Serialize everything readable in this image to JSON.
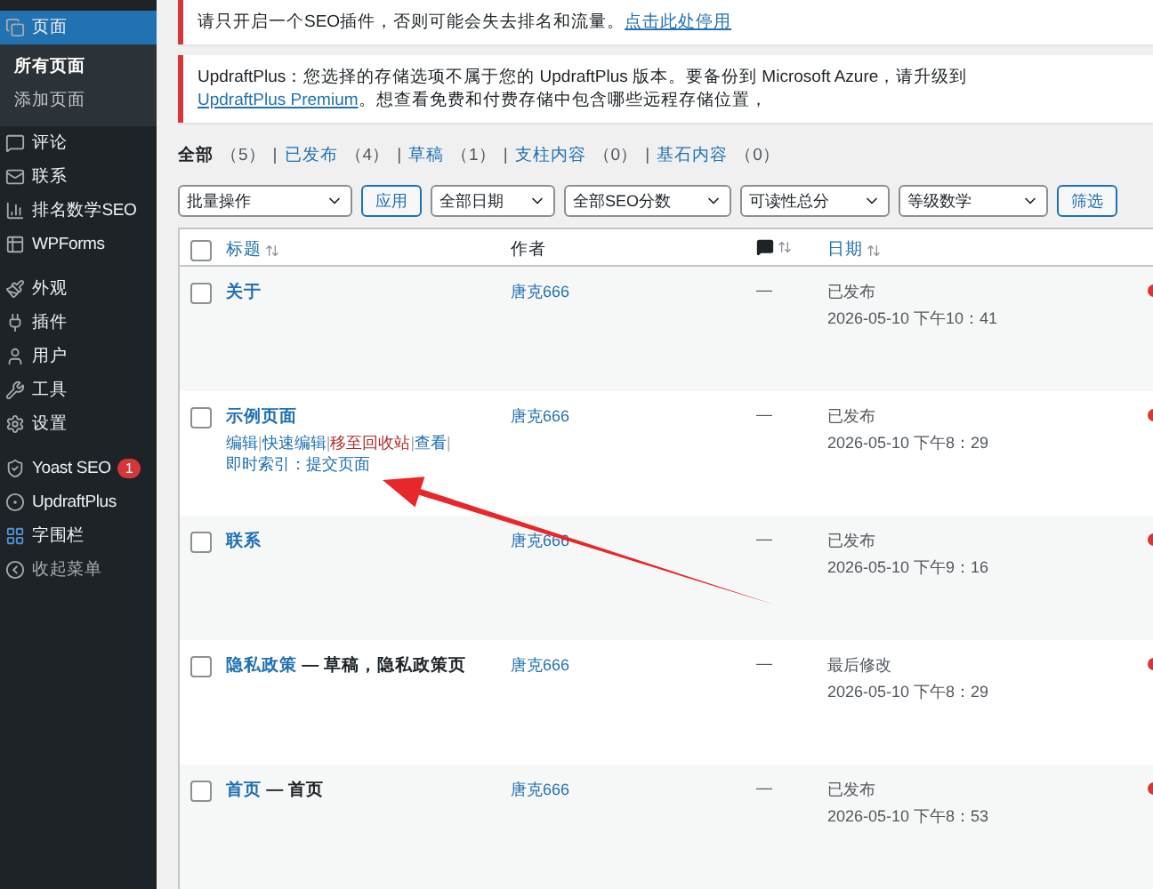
{
  "sidebar": {
    "items": [
      {
        "label": "页面",
        "selected": true,
        "children": [
          {
            "label": "所有页面",
            "selected": true
          },
          {
            "label": "添加页面",
            "selected": false
          }
        ]
      },
      {
        "label": "评论",
        "selected": false
      },
      {
        "label": "联系",
        "selected": false
      },
      {
        "label": "排名数学SEO",
        "selected": false
      },
      {
        "label": "WPForms",
        "selected": false
      },
      {
        "label": "外观",
        "selected": false
      },
      {
        "label": "插件",
        "selected": false
      },
      {
        "label": "用户",
        "selected": false
      },
      {
        "label": "工具",
        "selected": false
      },
      {
        "label": "设置",
        "selected": false
      },
      {
        "label": "Yoast SEO",
        "selected": false,
        "badge": "1"
      },
      {
        "label": "UpdraftPlus",
        "selected": false
      },
      {
        "label": "字围栏",
        "selected": false
      },
      {
        "label": "收起菜单",
        "selected": false
      }
    ]
  },
  "notices": [
    {
      "before": "请只开启一个SEO插件，否则可能会失去排名和流量。",
      "link": "点击此处停用"
    },
    {
      "before": "UpdraftPlus：您选择的存储选项不属于您的 UpdraftPlus 版本。要备份到 Microsoft Azure，请升级到 ",
      "link": "UpdraftPlus Premium",
      "after": "。想查看免费和付费存储中包含哪些远程存储位置，"
    }
  ],
  "status_filters": {
    "separator": "|",
    "items": [
      {
        "label": "全部",
        "count": "（5）",
        "selected": true
      },
      {
        "label": "已发布",
        "count": "（4）",
        "selected": false
      },
      {
        "label": "草稿",
        "count": "（1）",
        "selected": false
      },
      {
        "label": "支柱内容",
        "count": "（0）",
        "selected": false
      },
      {
        "label": "基石内容",
        "count": "（0）",
        "selected": false
      }
    ]
  },
  "toolbar": [
    {
      "kind": "select",
      "value": "批量操作"
    },
    {
      "kind": "button",
      "label": "应用"
    },
    {
      "kind": "select",
      "value": "全部日期"
    },
    {
      "kind": "select",
      "value": "全部SEO分数"
    },
    {
      "kind": "select",
      "value": "可读性总分"
    },
    {
      "kind": "select",
      "value": "等级数学"
    },
    {
      "kind": "button",
      "label": "筛选"
    }
  ],
  "table": {
    "select_all_checked": false,
    "columns": [
      {
        "label": "标题",
        "sortable": true
      },
      {
        "label": "作者",
        "sortable": false
      },
      {
        "sortable": true
      },
      {
        "label": "日期",
        "sortable": true
      }
    ],
    "row_action_separator": "|",
    "rows": [
      {
        "checked": false,
        "title": "关于",
        "author": "唐克666",
        "comments": "—",
        "status": "已发布",
        "date": "2026-05-10 下午10：41",
        "color": "#d63638"
      },
      {
        "checked": false,
        "title": "示例页面",
        "author": "唐克666",
        "comments": "—",
        "status": "已发布",
        "date": "2026-05-10 下午8：29",
        "color": "#d63638",
        "actions": [
          {
            "label": "编辑",
            "kind": "normal"
          },
          {
            "label": "快速编辑",
            "kind": "normal"
          },
          {
            "label": "移至回收站",
            "kind": "danger"
          },
          {
            "label": "查看",
            "kind": "normal"
          },
          {
            "label": "即时索引：提交页面",
            "kind": "normal"
          }
        ]
      },
      {
        "checked": false,
        "title": "联系",
        "author": "唐克666",
        "comments": "—",
        "status": "已发布",
        "date": "2026-05-10 下午9：16",
        "color": "#d63638"
      },
      {
        "checked": false,
        "title": "隐私政策",
        "suffix": " — 草稿，隐私政策页",
        "author": "唐克666",
        "comments": "—",
        "status": "最后修改",
        "date": "2026-05-10 下午8：29",
        "color": "#d63638"
      },
      {
        "checked": false,
        "title": "首页",
        "suffix": " — 首页",
        "author": "唐克666",
        "comments": "—",
        "status": "已发布",
        "date": "2026-05-10 下午8：53",
        "color": "#d63638"
      }
    ]
  }
}
